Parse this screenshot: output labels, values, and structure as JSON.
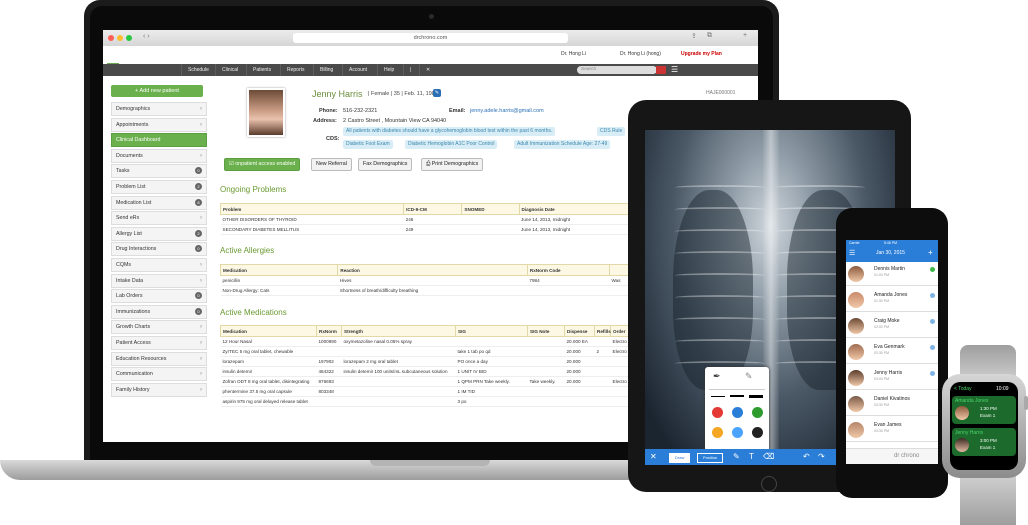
{
  "browser": {
    "url": "drchrono.com"
  },
  "app": {
    "logo_dr": "dr",
    "logo_chrono": "chrono",
    "user_name": "Dr. Hong Li",
    "user_role": "Dr. Hong Li (hong)",
    "upgrade": "Upgrade my Plan",
    "nav": [
      "Schedule",
      "Clinical",
      "Patients",
      "Reports",
      "Billing",
      "Account",
      "Help"
    ],
    "search_placeholder": "Search"
  },
  "sidebar": {
    "add_button": "+ Add new patient",
    "items": [
      {
        "label": "Demographics",
        "badge": ""
      },
      {
        "label": "Appointments",
        "badge": ""
      },
      {
        "label": "Clinical Dashboard",
        "badge": "",
        "active": true
      },
      {
        "label": "Documents",
        "badge": ""
      },
      {
        "label": "Tasks",
        "badge": "0"
      },
      {
        "label": "Problem List",
        "badge": "2"
      },
      {
        "label": "Medication List",
        "badge": "8"
      },
      {
        "label": "Send eRx",
        "badge": ""
      },
      {
        "label": "Allergy List",
        "badge": "2"
      },
      {
        "label": "Drug Interactions",
        "badge": "0"
      },
      {
        "label": "CQMs",
        "badge": ""
      },
      {
        "label": "Intake Data",
        "badge": ""
      },
      {
        "label": "Lab Orders",
        "badge": "0"
      },
      {
        "label": "Immunizations",
        "badge": "0"
      },
      {
        "label": "Growth Charts",
        "badge": ""
      },
      {
        "label": "Patient Access",
        "badge": ""
      },
      {
        "label": "Education Resources",
        "badge": ""
      },
      {
        "label": "Communication",
        "badge": ""
      },
      {
        "label": "Family History",
        "badge": ""
      }
    ]
  },
  "patient": {
    "name": "Jenny Harris",
    "demographics": "| Female | 35 | Feb. 11, 1980 |",
    "id": "HAJE000001",
    "phone_label": "Phone:",
    "phone": "516-232-2321",
    "email_label": "Email:",
    "email": "jenny.adele.harris@gmail.com",
    "address_label": "Address:",
    "address": "2 Castro Street , Mountain View CA 94040",
    "cds_label": "CDS:",
    "cds_alerts": [
      "All patients with diabetes should have a glycohemoglobin blood test within the past 6 months.",
      "CDS Rule",
      "Diabetic Foot Exam",
      "Diabetic Hemoglobin A1C Poor Control",
      "Adult Immunization Schedule Age: 27-49"
    ],
    "buttons": [
      "onpatient access enabled",
      "New Referral",
      "Fax Demographics",
      "Print Demographics"
    ]
  },
  "problems": {
    "title": "Ongoing Problems",
    "columns": [
      "Problem",
      "ICD-9-CM",
      "SNOMED",
      "Diagnosis Date"
    ],
    "rows": [
      [
        "OTHER DISORDERS OF THYROID",
        "246",
        "",
        "June 14, 2013, midnight"
      ],
      [
        "SECONDARY DIABETES MELLITUS",
        "249",
        "",
        "June 14, 2013, midnight"
      ]
    ]
  },
  "allergies": {
    "title": "Active Allergies",
    "columns": [
      "Medication",
      "Reaction",
      "RxNorm Code",
      ""
    ],
    "rows": [
      [
        "penicillin",
        "Hives",
        "7984",
        "Was"
      ],
      [
        "Non-Drug Allergy: Cats",
        "Shortness of breath/difficulty breathing",
        "",
        ""
      ]
    ]
  },
  "medications": {
    "title": "Active Medications",
    "columns": [
      "Medication",
      "RxNorm",
      "Strength",
      "SIG",
      "SIG Note",
      "Dispense",
      "Refills",
      "Order"
    ],
    "rows": [
      [
        "12 Hour Nasal",
        "1000990",
        "oxymetazoline nasal 0.05% spray",
        "",
        "",
        "20.000 EA",
        "",
        "Electro"
      ],
      [
        "ZyrTEC 5 mg oral tablet, chewable",
        "",
        "",
        "take 1 tab po qd",
        "",
        "20.000",
        "2",
        "Electro"
      ],
      [
        "lorazepam",
        "197902",
        "lorazepam 2 mg oral tablet",
        "PO once a day",
        "",
        "20.000",
        "",
        ""
      ],
      [
        "insulin detemir",
        "484322",
        "insulin detemir 100 units/mL subcutaneous solution",
        "1 UNIT IV BID",
        "",
        "20.000",
        "",
        ""
      ],
      [
        "Zofran ODT 8 mg oral tablet, disintegrating",
        "876693",
        "",
        "1 QPM PRN Take weekly.",
        "Take weekly.",
        "20.000",
        "",
        "Electro"
      ],
      [
        "phentermine 37.5 mg oral capsule",
        "803348",
        "",
        "1 IM TID",
        "",
        "",
        "",
        ""
      ],
      [
        "aspirin 975 mg oral delayed release tablet",
        "",
        "",
        "3 po",
        "",
        "",
        "",
        ""
      ]
    ]
  },
  "tablet": {
    "toolbar_buttons": [
      "Draw",
      "Position"
    ]
  },
  "phone": {
    "carrier": "Carrier",
    "time": "5:46 PM",
    "date": "Jan 30, 2015",
    "patients": [
      {
        "name": "Dennis Martin",
        "time": "01:00 PM",
        "status": "#3cb84a"
      },
      {
        "name": "Amanda Jones",
        "time": "01:30 PM",
        "status": "#7fb5e6"
      },
      {
        "name": "Craig Moke",
        "time": "02:00 PM",
        "status": "#7fb5e6"
      },
      {
        "name": "Eva Genmark",
        "time": "02:30 PM",
        "status": "#7fb5e6"
      },
      {
        "name": "Jenny Harris",
        "time": "03:00 PM",
        "status": "#7fb5e6"
      },
      {
        "name": "Daniel Kivatinos",
        "time": "03:30 PM",
        "status": ""
      },
      {
        "name": "Evan James",
        "time": "03:30 PM",
        "status": ""
      }
    ],
    "footer_logo": "dr chrono"
  },
  "watch": {
    "back": "< Today",
    "time": "10:09",
    "entries": [
      {
        "name": "Amanda Jones",
        "time": "1:30 PM",
        "room": "Exam 1"
      },
      {
        "name": "Jenny Harris",
        "time": "3:00 PM",
        "room": "Exam 1"
      }
    ]
  }
}
